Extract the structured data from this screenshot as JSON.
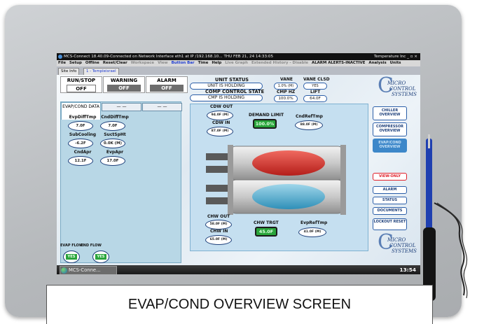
{
  "window": {
    "title": "MCS-Connect 18.40.09-Connected on Network Interface eth1 at IP /192.168.10...  THU FEB 21, 24  14:33:05",
    "title_right": "Temperature Inc  _ ▫ ×"
  },
  "menu": [
    {
      "label": "File",
      "style": "normal"
    },
    {
      "label": "Setup",
      "style": "normal"
    },
    {
      "label": "Offline",
      "style": "normal"
    },
    {
      "label": "Reset/Clear",
      "style": "normal"
    },
    {
      "label": "Workspace",
      "style": "dim"
    },
    {
      "label": "View",
      "style": "dim"
    },
    {
      "label": "Button Bar",
      "style": "blue"
    },
    {
      "label": "Time",
      "style": "normal"
    },
    {
      "label": "Help",
      "style": "normal"
    },
    {
      "label": "Live Graph",
      "style": "dim"
    },
    {
      "label": "Extended History - Disable",
      "style": "dim"
    },
    {
      "label": "ALARM ALERTS-INACTIVE",
      "style": "normal"
    },
    {
      "label": "Analysis",
      "style": "normal"
    },
    {
      "label": "Units",
      "style": "normal"
    }
  ],
  "tabs": {
    "site_info": "Site Info",
    "site": "1 - Templeisrael"
  },
  "status": {
    "run_stop": {
      "label": "RUN/STOP",
      "value": "OFF"
    },
    "warning": {
      "label": "WARNING",
      "value": "OFF"
    },
    "alarm": {
      "label": "ALARM",
      "value": "OFF"
    }
  },
  "unit_status": {
    "label": "UNIT STATUS",
    "value": "UNIT IS HOLDING"
  },
  "comp_state": {
    "label": "COMP CONTROL STATE",
    "value": "CMP IS HOLDING"
  },
  "vane": {
    "label": "VANE",
    "value": "1.0% (M)"
  },
  "vane_clsd": {
    "label": "VANE CLSD",
    "value": "YES"
  },
  "cmp_hz": {
    "label": "CMP HZ",
    "value": "100.0%"
  },
  "lift": {
    "label": "LIFT",
    "value": "64.0F"
  },
  "left_panel": {
    "tab1": "EVAP/COND DATA",
    "tab2": "— —",
    "tab3": "— —",
    "fields": [
      {
        "label": "EvpDiffTmp",
        "value": "7.0F"
      },
      {
        "label": "CndDiffTmp",
        "value": "7.0F"
      },
      {
        "label": "SubCooling",
        "value": "-6.2F"
      },
      {
        "label": "SuctSpHt",
        "value": "0.0K (M)"
      },
      {
        "label": "CndApr",
        "value": "12.1F"
      },
      {
        "label": "EvpApr",
        "value": "17.0F"
      }
    ]
  },
  "flows": {
    "evap_label": "EVAP FLOW",
    "cnd_label": "CND FLOW",
    "evap_value": "YES",
    "cnd_value": "YES"
  },
  "diagram": {
    "cdw_out": {
      "label": "CDW OUT",
      "value": "94.0F (M)"
    },
    "cdw_in": {
      "label": "CDW IN",
      "value": "87.0F (M)"
    },
    "demand_limit": {
      "label": "DEMAND LIMIT",
      "value": "100.0%"
    },
    "cnd_ref_tmp": {
      "label": "CndRefTmp",
      "value": "88.0F (M)"
    },
    "chw_out": {
      "label": "CHW OUT",
      "value": "58.0F (M)"
    },
    "chw_in": {
      "label": "CHW IN",
      "value": "65.0F (M)"
    },
    "chw_trgt": {
      "label": "CHW TRGT",
      "value": "45.0F"
    },
    "evp_ref_tmp": {
      "label": "EvpRefTmp",
      "value": "41.0F (M)"
    }
  },
  "sidebar": [
    "CHILLER OVERVIEW",
    "COMPRESSOR OVERVIEW",
    "EVAP/COND OVERVIEW",
    "VIEW-ONLY",
    "ALARM",
    "STATUS",
    "DOCUMENTS",
    "LOCKOUT RESET"
  ],
  "logo": {
    "line1": "MICRO",
    "line2": "CONTROL",
    "line3": "SYSTEMS"
  },
  "taskbar": {
    "app": "MCS-Conne...",
    "clock": "13:54"
  },
  "caption": "EVAP/COND OVERVIEW SCREEN",
  "colors": {
    "accent": "#2b5ea8",
    "green_value": "#2aa43b",
    "cond_shell": "#e03a33",
    "evap_shell": "#5db8d8",
    "view_only": "#e0202a"
  }
}
